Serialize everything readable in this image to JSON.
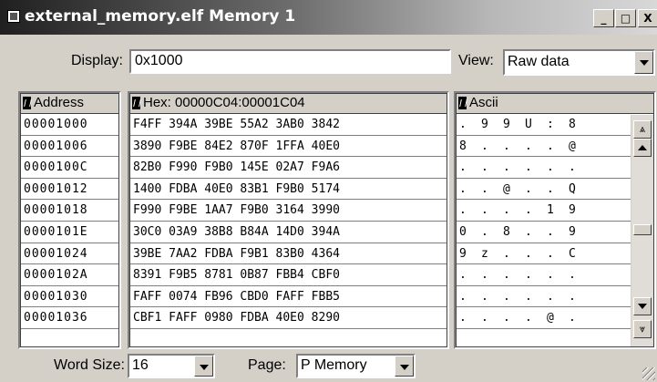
{
  "window": {
    "title": "external_memory.elf Memory 1",
    "buttons": {
      "minimize": "_",
      "maximize": "□",
      "close": "X"
    }
  },
  "display": {
    "label": "Display:",
    "value": "0x1000"
  },
  "view": {
    "label": "View:",
    "value": "Raw data"
  },
  "columns": {
    "address_header": "Address",
    "hex_header": "Hex: 00000C04:00001C04",
    "ascii_header": "Ascii"
  },
  "addresses": [
    "00001000",
    "00001006",
    "0000100C",
    "00001012",
    "00001018",
    "0000101E",
    "00001024",
    "0000102A",
    "00001030",
    "00001036"
  ],
  "hex_rows": [
    "F4FF 394A 39BE 55A2 3AB0 3842",
    "3890 F9BE 84E2 870F 1FFA 40E0",
    "82B0 F990 F9B0 145E 02A7 F9A6",
    "1400 FDBA 40E0 83B1 F9B0 5174",
    "F990 F9BE 1AA7 F9B0 3164 3990",
    "30C0 03A9 38B8 B84A 14D0 394A",
    "39BE 7AA2 FDBA F9B1 83B0 4364",
    "8391 F9B5 8781 0B87 FBB4 CBF0",
    "FAFF 0074 FB96 CBD0 FAFF FBB5",
    "CBF1 FAFF 0980 FDBA 40E0 8290"
  ],
  "ascii_rows": [
    [
      ".",
      "9",
      "9",
      "U",
      ":",
      "8"
    ],
    [
      "8",
      ".",
      ".",
      ".",
      ".",
      "@"
    ],
    [
      ".",
      ".",
      ".",
      ".",
      ".",
      "."
    ],
    [
      ".",
      ".",
      "@",
      ".",
      ".",
      "Q"
    ],
    [
      ".",
      ".",
      ".",
      ".",
      "1",
      "9"
    ],
    [
      "0",
      ".",
      "8",
      ".",
      ".",
      "9"
    ],
    [
      "9",
      "z",
      ".",
      ".",
      ".",
      "C"
    ],
    [
      ".",
      ".",
      ".",
      ".",
      ".",
      "."
    ],
    [
      ".",
      ".",
      ".",
      ".",
      ".",
      "."
    ],
    [
      ".",
      ".",
      ".",
      ".",
      "@",
      "."
    ]
  ],
  "scrollbar": {
    "page_up": "⩓",
    "page_down": "⩔"
  },
  "word_size": {
    "label": "Word Size:",
    "value": "16"
  },
  "page": {
    "label": "Page:",
    "value": "P Memory"
  }
}
